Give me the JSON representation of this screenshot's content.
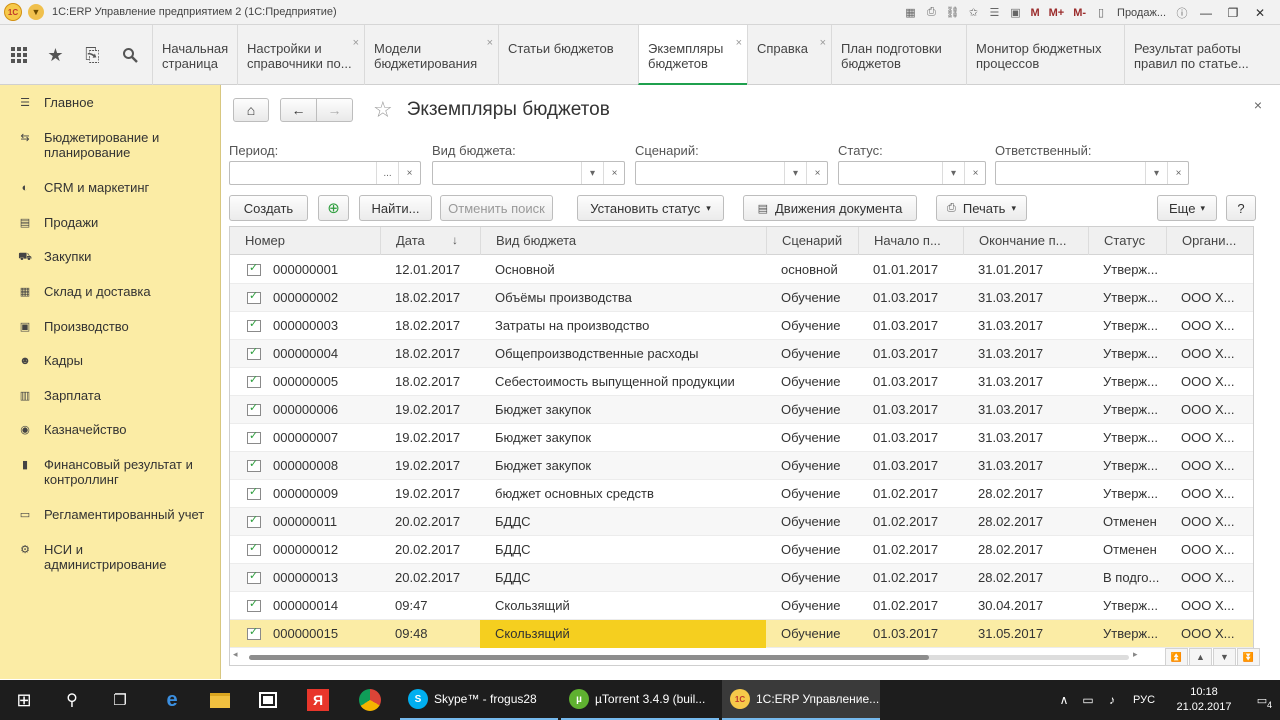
{
  "window": {
    "title": "1С:ERP Управление предприятием 2  (1С:Предприятие)",
    "logo_text": "1С",
    "tools_m": [
      "M",
      "M+",
      "M-"
    ],
    "user": "Продаж...",
    "win_minimize": "—",
    "win_maximize": "❐",
    "win_close": "✕"
  },
  "quick_icons": [
    {
      "name": "apps-grid-icon",
      "glyph": "⋮⋮⋮"
    },
    {
      "name": "favorites-star-icon",
      "glyph": "★"
    },
    {
      "name": "history-icon",
      "glyph": "⎘"
    },
    {
      "name": "search-icon",
      "glyph": "⚲"
    }
  ],
  "tabs": [
    {
      "label": "Начальная страница",
      "closable": false,
      "active": false
    },
    {
      "label": "Настройки и справочники по...",
      "closable": true,
      "active": false
    },
    {
      "label": "Модели бюджетирования",
      "closable": true,
      "active": false
    },
    {
      "label": "Статьи бюджетов",
      "closable": false,
      "active": false
    },
    {
      "label": "Экземпляры бюджетов",
      "closable": true,
      "active": true
    },
    {
      "label": "Справка",
      "closable": true,
      "active": false
    },
    {
      "label": "План подготовки бюджетов",
      "closable": false,
      "active": false
    },
    {
      "label": "Монитор бюджетных процессов",
      "closable": false,
      "active": false
    },
    {
      "label": "Результат работы правил по статье...",
      "closable": false,
      "active": false
    }
  ],
  "sidebar": {
    "items": [
      {
        "label": "Главное",
        "icon": "☰"
      },
      {
        "label": "Бюджетирование и планирование",
        "icon": "⇆"
      },
      {
        "label": "CRM и маркетинг",
        "icon": "◐"
      },
      {
        "label": "Продажи",
        "icon": "▤"
      },
      {
        "label": "Закупки",
        "icon": "⛟"
      },
      {
        "label": "Склад и доставка",
        "icon": "▦"
      },
      {
        "label": "Производство",
        "icon": "▣"
      },
      {
        "label": "Кадры",
        "icon": "☻"
      },
      {
        "label": "Зарплата",
        "icon": "▥"
      },
      {
        "label": "Казначейство",
        "icon": "◉"
      },
      {
        "label": "Финансовый результат и контроллинг",
        "icon": "▮"
      },
      {
        "label": "Регламентированный учет",
        "icon": "▭"
      },
      {
        "label": "НСИ и администрирование",
        "icon": "⚙"
      }
    ]
  },
  "page": {
    "title": "Экземпляры бюджетов",
    "close": "×",
    "home_icon": "⌂",
    "back_icon": "←",
    "forward_icon": "→",
    "star_icon": "☆"
  },
  "filters": {
    "period_label": "Период:",
    "budget_type_label": "Вид бюджета:",
    "scenario_label": "Сценарий:",
    "status_label": "Статус:",
    "responsible_label": "Ответственный:",
    "dots": "...",
    "clear": "×",
    "dropdown": "▾"
  },
  "buttons": {
    "create": "Создать",
    "add_icon": "⊕",
    "find": "Найти...",
    "cancel_search": "Отменить поиск",
    "set_status": "Установить статус",
    "doc_movements": "Движения документа",
    "print": "Печать",
    "more": "Еще",
    "help": "?",
    "dropdown": "▾"
  },
  "table": {
    "columns": [
      "Номер",
      "Дата",
      "Вид бюджета",
      "Сценарий",
      "Начало п...",
      "Окончание п...",
      "Статус",
      "Органи..."
    ],
    "sort_indicator": "↓",
    "rows": [
      [
        "000000001",
        "12.01.2017",
        "Основной",
        "основной",
        "01.01.2017",
        "31.01.2017",
        "Утверж...",
        ""
      ],
      [
        "000000002",
        "18.02.2017",
        "Объёмы производства",
        "Обучение",
        "01.03.2017",
        "31.03.2017",
        "Утверж...",
        "ООО Х..."
      ],
      [
        "000000003",
        "18.02.2017",
        "Затраты на производство",
        "Обучение",
        "01.03.2017",
        "31.03.2017",
        "Утверж...",
        "ООО Х..."
      ],
      [
        "000000004",
        "18.02.2017",
        "Общепроизводственные расходы",
        "Обучение",
        "01.03.2017",
        "31.03.2017",
        "Утверж...",
        "ООО Х..."
      ],
      [
        "000000005",
        "18.02.2017",
        "Себестоимость выпущенной продукции",
        "Обучение",
        "01.03.2017",
        "31.03.2017",
        "Утверж...",
        "ООО Х..."
      ],
      [
        "000000006",
        "19.02.2017",
        "Бюджет закупок",
        "Обучение",
        "01.03.2017",
        "31.03.2017",
        "Утверж...",
        "ООО Х..."
      ],
      [
        "000000007",
        "19.02.2017",
        "Бюджет закупок",
        "Обучение",
        "01.03.2017",
        "31.03.2017",
        "Утверж...",
        "ООО Х..."
      ],
      [
        "000000008",
        "19.02.2017",
        "Бюджет закупок",
        "Обучение",
        "01.03.2017",
        "31.03.2017",
        "Утверж...",
        "ООО Х..."
      ],
      [
        "000000009",
        "19.02.2017",
        "бюджет основных средств",
        "Обучение",
        "01.02.2017",
        "28.02.2017",
        "Утверж...",
        "ООО Х..."
      ],
      [
        "000000011",
        "20.02.2017",
        "БДДС",
        "Обучение",
        "01.02.2017",
        "28.02.2017",
        "Отменен",
        "ООО Х..."
      ],
      [
        "000000012",
        "20.02.2017",
        "БДДС",
        "Обучение",
        "01.02.2017",
        "28.02.2017",
        "Отменен",
        "ООО Х..."
      ],
      [
        "000000013",
        "20.02.2017",
        "БДДС",
        "Обучение",
        "01.02.2017",
        "28.02.2017",
        "В подго...",
        "ООО Х..."
      ],
      [
        "000000014",
        "09:47",
        "Скользящий",
        "Обучение",
        "01.02.2017",
        "30.04.2017",
        "Утверж...",
        "ООО Х..."
      ],
      [
        "000000015",
        "09:48",
        "Скользящий",
        "Обучение",
        "01.03.2017",
        "31.05.2017",
        "Утверж...",
        "ООО Х..."
      ]
    ],
    "selected_row": 14,
    "scroll_left": "◂",
    "scroll_right": "▸",
    "nav": [
      "⏫",
      "▲",
      "▼",
      "⏬"
    ]
  },
  "taskbar": {
    "start_icon": "⊞",
    "search_icon": "⚲",
    "taskview_icon": "❐",
    "apps": [
      {
        "label": "Skype™ - frogus28",
        "icon": "S",
        "color": "#00aff0",
        "active": false
      },
      {
        "label": "µTorrent 3.4.9  (buil...",
        "icon": "µ",
        "color": "#5fb130",
        "active": false
      },
      {
        "label": "1С:ERP Управление...",
        "icon": "1С",
        "color": "#f6c94a",
        "active": true
      }
    ],
    "tray_up": "∧",
    "tray_net": "▭",
    "tray_vol": "♪",
    "lang": "РУС",
    "time": "10:18",
    "date": "21.02.2017",
    "notif": "4"
  }
}
